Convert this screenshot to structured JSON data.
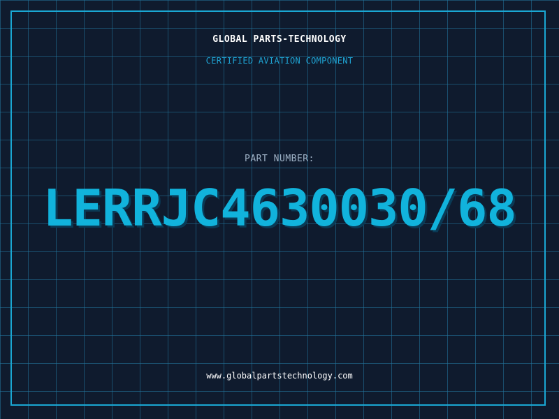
{
  "header": {
    "company_name": "GLOBAL PARTS-TECHNOLOGY",
    "tagline": "CERTIFIED AVIATION COMPONENT"
  },
  "part": {
    "label": "PART NUMBER:",
    "number": "LERRJC4630030/68"
  },
  "footer": {
    "website": "www.globalpartstechnology.com"
  },
  "colors": {
    "background": "#0f1b2e",
    "grid": "#2278a0",
    "accent": "#11b3dc",
    "frame": "#1aa7d3"
  }
}
